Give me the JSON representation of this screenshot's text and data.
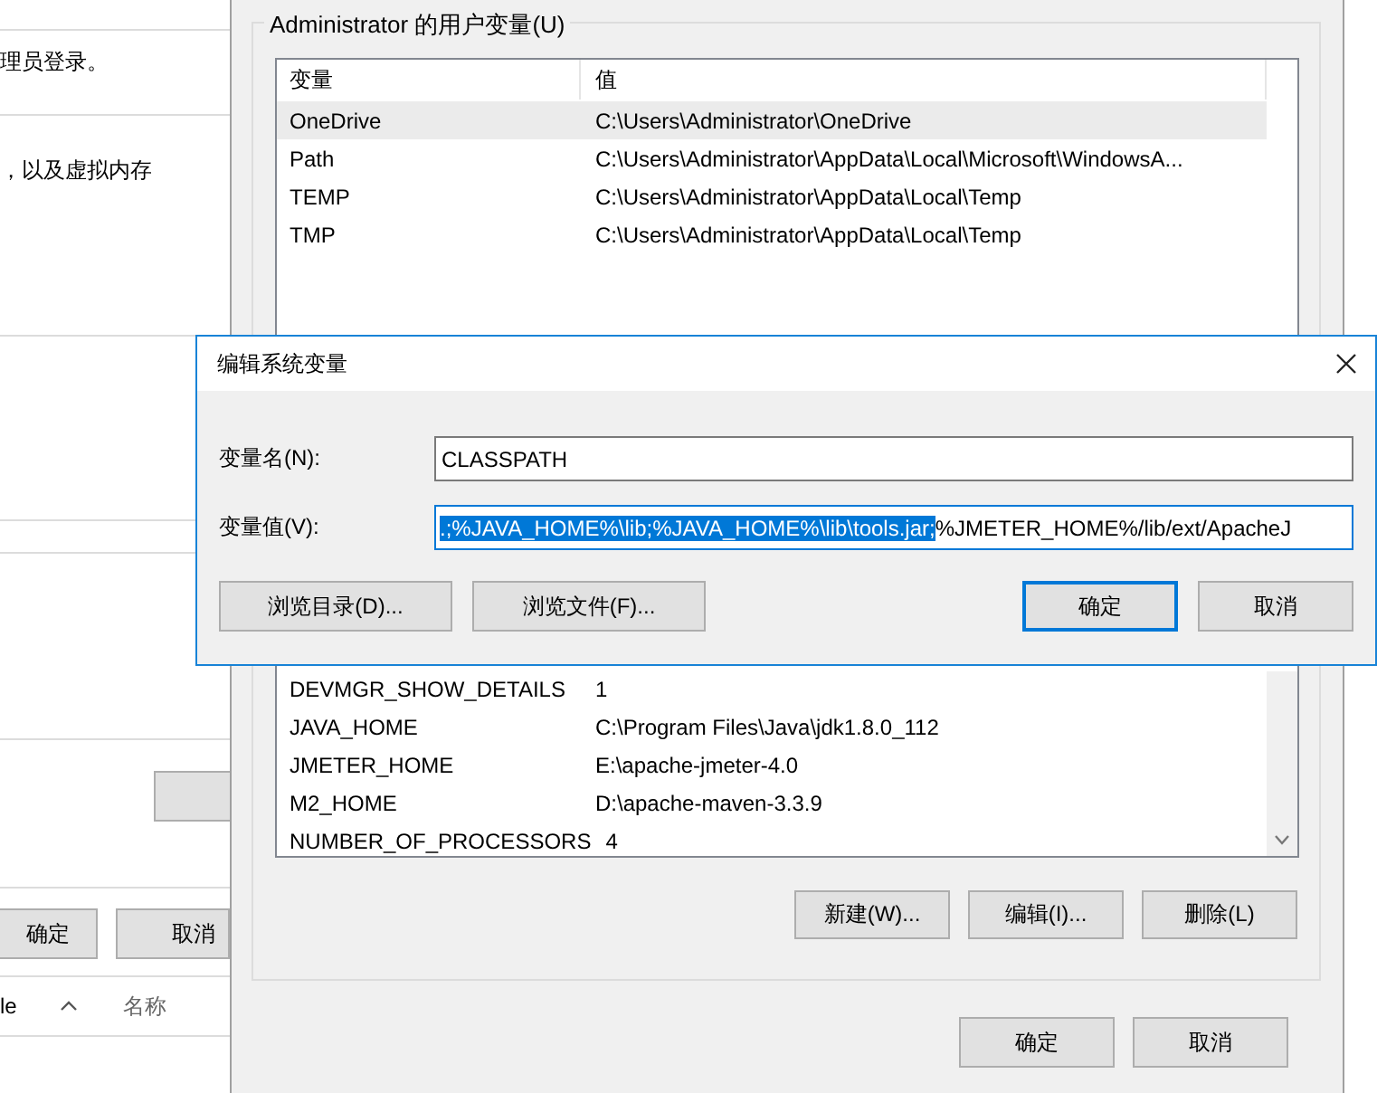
{
  "background_window": {
    "texts": [
      "理员登录。",
      "，以及虚拟内存"
    ],
    "buttons": [
      "确定",
      "取消"
    ],
    "list_header": {
      "column_1": "le",
      "column_2": "名称"
    }
  },
  "environment_window": {
    "user_variables": {
      "title": "Administrator 的用户变量(U)",
      "columns": [
        "变量",
        "值"
      ],
      "rows": [
        {
          "name": "OneDrive",
          "value": "C:\\Users\\Administrator\\OneDrive",
          "selected": true
        },
        {
          "name": "Path",
          "value": "C:\\Users\\Administrator\\AppData\\Local\\Microsoft\\WindowsA...",
          "selected": false
        },
        {
          "name": "TEMP",
          "value": "C:\\Users\\Administrator\\AppData\\Local\\Temp",
          "selected": false
        },
        {
          "name": "TMP",
          "value": "C:\\Users\\Administrator\\AppData\\Local\\Temp",
          "selected": false
        }
      ]
    },
    "system_variables": {
      "rows": [
        {
          "name": "DEVMGR_SHOW_DETAILS",
          "value": "1",
          "selected": false
        },
        {
          "name": "JAVA_HOME",
          "value": "C:\\Program Files\\Java\\jdk1.8.0_112",
          "selected": false
        },
        {
          "name": "JMETER_HOME",
          "value": "E:\\apache-jmeter-4.0",
          "selected": false
        },
        {
          "name": "M2_HOME",
          "value": "D:\\apache-maven-3.3.9",
          "selected": false
        },
        {
          "name": "NUMBER_OF_PROCESSORS",
          "value": "4",
          "selected": false
        }
      ],
      "buttons": [
        "新建(W)...",
        "编辑(I)...",
        "删除(L)"
      ]
    },
    "buttons": [
      {
        "label": "确定",
        "default": false
      },
      {
        "label": "取消",
        "default": false
      }
    ]
  },
  "dialog": {
    "title": "编辑系统变量",
    "name_label": "变量名(N):",
    "name_value": "CLASSPATH",
    "value_label": "变量值(V):",
    "value_selected": ".;%JAVA_HOME%\\lib;%JAVA_HOME%\\lib\\tools.jar;",
    "value_rest": "%JMETER_HOME%/lib/ext/ApacheJ",
    "browse_buttons": [
      "浏览目录(D)...",
      "浏览文件(F)..."
    ],
    "buttons": [
      {
        "label": "确定",
        "default": true
      },
      {
        "label": "取消",
        "default": false
      }
    ]
  }
}
